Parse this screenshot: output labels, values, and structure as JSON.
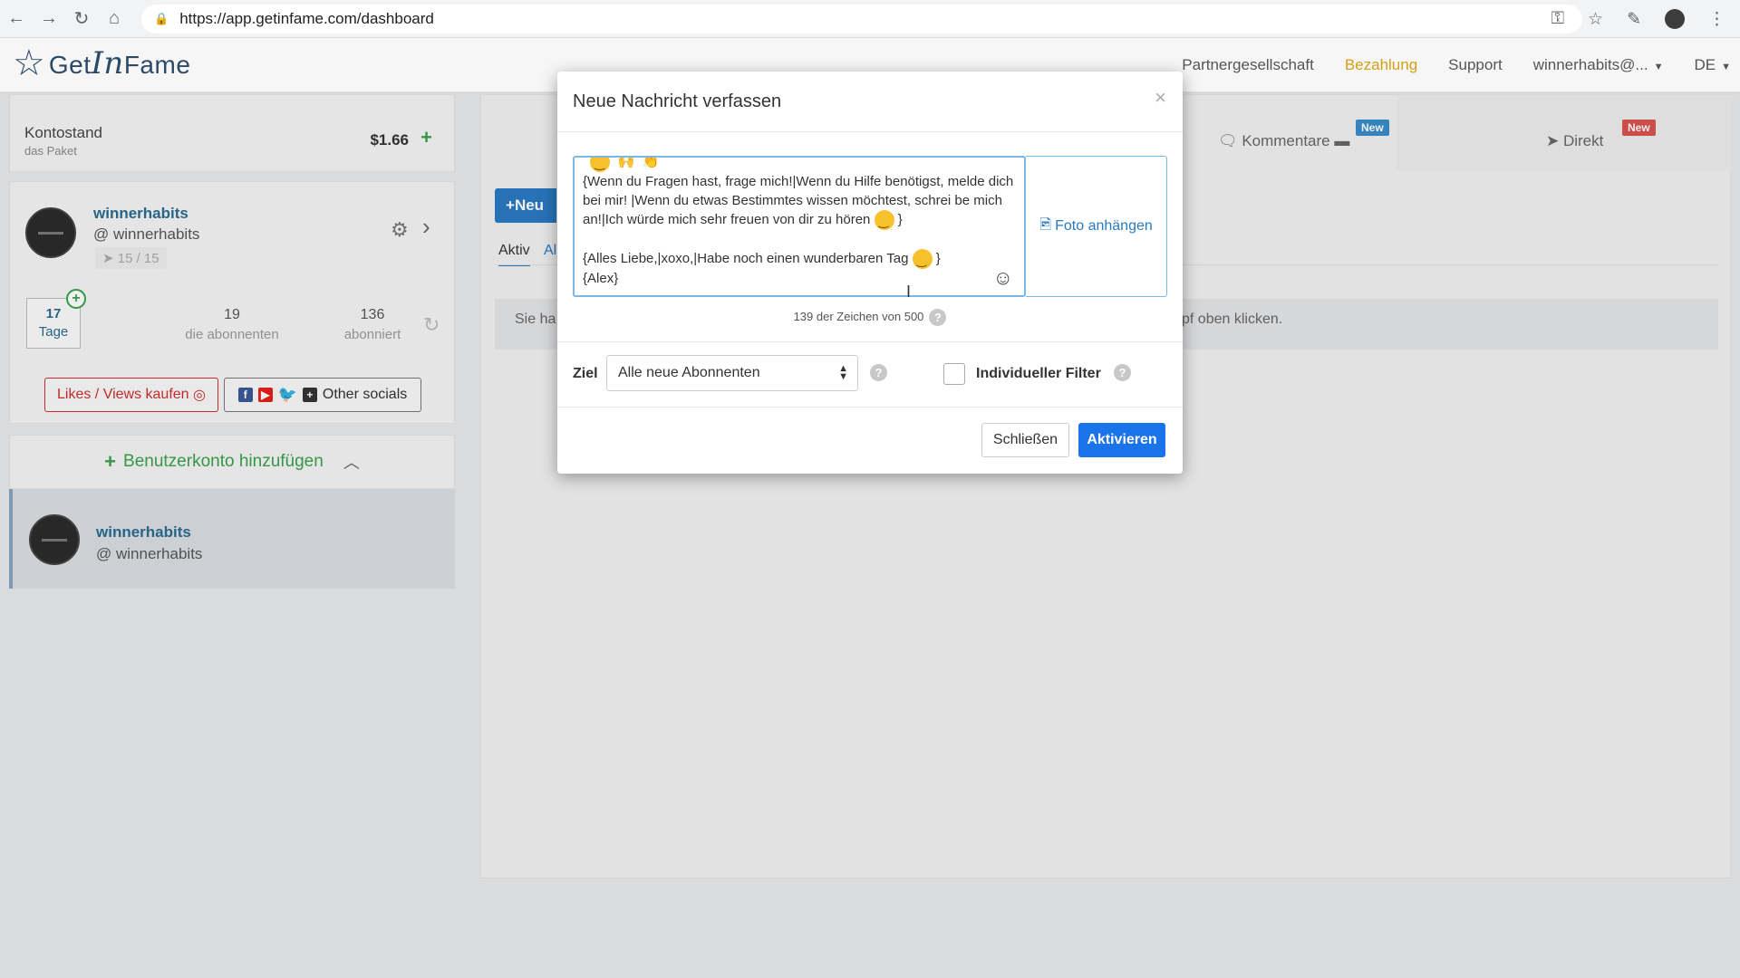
{
  "browser": {
    "url_host": "https://app.getinfame.com/dashboard"
  },
  "header": {
    "logo_get": "Get",
    "logo_in": "In",
    "logo_fame": "Fame",
    "nav": [
      "Partnergesellschaft",
      "Bezahlung",
      "Support"
    ],
    "user": "winnerhabits@...",
    "lang": "DE"
  },
  "sidebar": {
    "balance_label": "Kontostand",
    "balance_sub": "das Paket",
    "balance_amount": "$1.66",
    "account": {
      "name": "winnerhabits",
      "handle": "@ winnerhabits",
      "badge": "15 / 15",
      "days_num": "17",
      "days_label": "Tage",
      "followers_num": "19",
      "followers_label": "die abonnenten",
      "following_num": "136",
      "following_label": "abonniert"
    },
    "likes_button": "Likes / Views kaufen",
    "social_button": "Other socials",
    "add_account": "Benutzerkonto hinzufügen",
    "list_account": {
      "name": "winnerhabits",
      "handle": "@ winnerhabits"
    }
  },
  "main": {
    "tab_comments": "Kommentare",
    "tab_direct": "Direkt",
    "new_badge": "New",
    "btn_new": "Neu",
    "tab_active": "Aktiv",
    "tab_al": "Al",
    "info_left": "Sie ha",
    "info_right": "pf oben klicken."
  },
  "modal": {
    "title": "Neue Nachricht verfassen",
    "close": "×",
    "msg_line1": "{Wenn du Fragen hast, frage mich!|Wenn du Hilfe benötigst, melde dich bei mir! |Wenn du etwas Bestimmtes wissen möchtest, schrei be mich an!|Ich würde mich sehr freuen von dir zu hören",
    "msg_line2": "{Alles Liebe,|xoxo,|Habe noch einen wunderbaren Tag",
    "msg_line3": "{Alex}",
    "photo_attach": "Foto anhängen",
    "char_count": "139 der Zeichen von 500",
    "ziel_label": "Ziel",
    "ziel_value": "Alle neue Abonnenten",
    "filter_label": "Individueller Filter",
    "btn_close": "Schließen",
    "btn_activate": "Aktivieren"
  },
  "colors": {
    "primary": "#1a73e8",
    "green": "#3aa14d",
    "danger": "#c9302c",
    "gold": "#d4a017"
  }
}
